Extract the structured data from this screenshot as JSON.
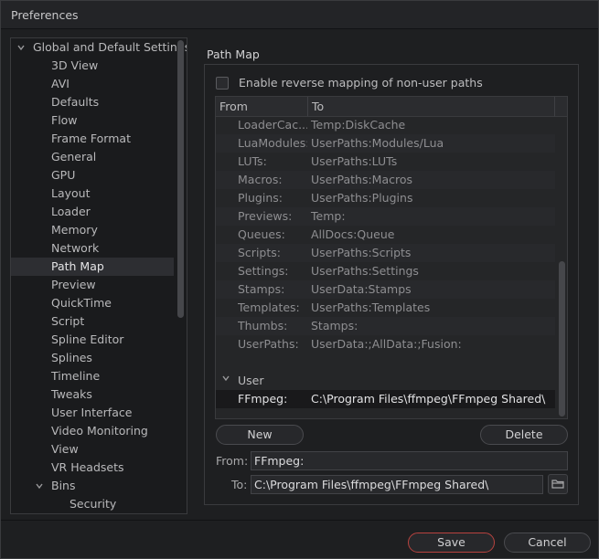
{
  "window": {
    "title": "Preferences"
  },
  "tree": {
    "items": [
      {
        "label": "Global and Default Settings",
        "level": 0,
        "expandable": true
      },
      {
        "label": "3D View",
        "level": 1
      },
      {
        "label": "AVI",
        "level": 1
      },
      {
        "label": "Defaults",
        "level": 1
      },
      {
        "label": "Flow",
        "level": 1
      },
      {
        "label": "Frame Format",
        "level": 1
      },
      {
        "label": "General",
        "level": 1
      },
      {
        "label": "GPU",
        "level": 1
      },
      {
        "label": "Layout",
        "level": 1
      },
      {
        "label": "Loader",
        "level": 1
      },
      {
        "label": "Memory",
        "level": 1
      },
      {
        "label": "Network",
        "level": 1
      },
      {
        "label": "Path Map",
        "level": 1,
        "selected": true
      },
      {
        "label": "Preview",
        "level": 1
      },
      {
        "label": "QuickTime",
        "level": 1
      },
      {
        "label": "Script",
        "level": 1
      },
      {
        "label": "Spline Editor",
        "level": 1
      },
      {
        "label": "Splines",
        "level": 1
      },
      {
        "label": "Timeline",
        "level": 1
      },
      {
        "label": "Tweaks",
        "level": 1
      },
      {
        "label": "User Interface",
        "level": 1
      },
      {
        "label": "Video Monitoring",
        "level": 1
      },
      {
        "label": "View",
        "level": 1
      },
      {
        "label": "VR Headsets",
        "level": 1
      },
      {
        "label": "Bins",
        "level": 1,
        "expandable": true
      },
      {
        "label": "Security",
        "level": 2
      }
    ]
  },
  "path_map": {
    "title": "Path Map",
    "reverse_mapping_label": "Enable reverse mapping of non-user paths",
    "reverse_mapping_checked": false,
    "columns": {
      "from": "From",
      "to": "To"
    },
    "system_rows": [
      {
        "from": "LoaderCac...",
        "to": "Temp:DiskCache"
      },
      {
        "from": "LuaModules:",
        "to": "UserPaths:Modules/Lua"
      },
      {
        "from": "LUTs:",
        "to": "UserPaths:LUTs"
      },
      {
        "from": "Macros:",
        "to": "UserPaths:Macros"
      },
      {
        "from": "Plugins:",
        "to": "UserPaths:Plugins"
      },
      {
        "from": "Previews:",
        "to": "Temp:"
      },
      {
        "from": "Queues:",
        "to": "AllDocs:Queue"
      },
      {
        "from": "Scripts:",
        "to": "UserPaths:Scripts"
      },
      {
        "from": "Settings:",
        "to": "UserPaths:Settings"
      },
      {
        "from": "Stamps:",
        "to": "UserData:Stamps"
      },
      {
        "from": "Templates:",
        "to": "UserPaths:Templates"
      },
      {
        "from": "Thumbs:",
        "to": "Stamps:"
      },
      {
        "from": "UserPaths:",
        "to": "UserData:;AllData:;Fusion:"
      }
    ],
    "user_group_label": "User",
    "user_rows": [
      {
        "from": "FFmpeg:",
        "to": "C:\\Program Files\\ffmpeg\\FFmpeg Shared\\"
      }
    ],
    "new_label": "New",
    "delete_label": "Delete",
    "from_label": "From:",
    "from_value": "FFmpeg:",
    "to_label": "To:",
    "to_value": "C:\\Program Files\\ffmpeg\\FFmpeg Shared\\"
  },
  "footer": {
    "save_label": "Save",
    "cancel_label": "Cancel"
  },
  "colors": {
    "accent": "#b8433f",
    "background": "#1e1f21",
    "selection": "#2d2e32"
  },
  "icons": {
    "expand": "chevron-down-icon",
    "browse": "folder-icon"
  }
}
